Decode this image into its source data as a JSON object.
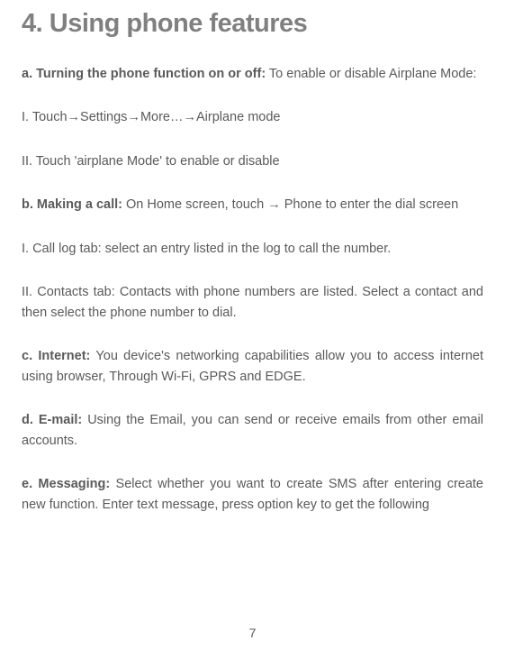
{
  "heading": {
    "number": "4.",
    "title": "Using phone features"
  },
  "sections": {
    "a": {
      "label": "a. Turning the phone function on or off:",
      "text": " To enable or disable Airplane Mode:"
    },
    "a_step1_prefix": "I. Touch",
    "a_step1_parts": {
      "p1": "Settings",
      "p2": "More…",
      "p3": "Airplane mode"
    },
    "a_step2": "II. Touch 'airplane Mode' to enable or disable",
    "b": {
      "label": "b. Making a call:",
      "text_before": " On Home screen, touch ",
      "text_after": " Phone to enter the dial screen"
    },
    "b_step1": "I. Call log tab: select an entry listed in the log to call the number.",
    "b_step2": "II. Contacts tab: Contacts with phone numbers are listed. Select a contact and then select the phone number to dial.",
    "c": {
      "label": "c. Internet:",
      "text": " You device's networking capabilities allow you to access internet using browser, Through Wi-Fi, GPRS and EDGE."
    },
    "d": {
      "label": "d. E-mail:",
      "text": " Using the Email, you can send or receive emails from other email accounts."
    },
    "e": {
      "label": "e. Messaging:",
      "text": " Select whether you want to create SMS after entering create new function. Enter text message, press option key to get the following"
    }
  },
  "arrow": "→",
  "pageNumber": "7"
}
